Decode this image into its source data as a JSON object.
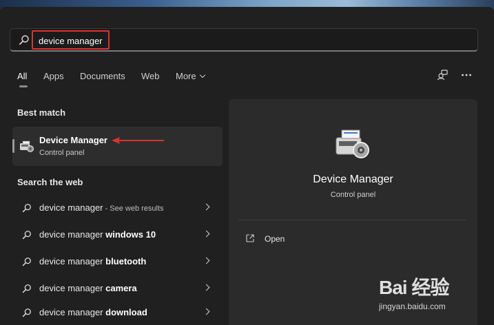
{
  "search": {
    "query": "device manager"
  },
  "tabs": [
    {
      "label": "All",
      "active": true
    },
    {
      "label": "Apps"
    },
    {
      "label": "Documents"
    },
    {
      "label": "Web"
    },
    {
      "label": "More"
    }
  ],
  "best_match": {
    "heading": "Best match",
    "title": "Device Manager",
    "subtitle": "Control panel",
    "icon": "device-manager-icon"
  },
  "web": {
    "heading": "Search the web",
    "results": [
      {
        "prefix": "device manager",
        "bold": "",
        "hint": " - See web results"
      },
      {
        "prefix": "device manager ",
        "bold": "windows 10",
        "hint": ""
      },
      {
        "prefix": "device manager ",
        "bold": "bluetooth",
        "hint": ""
      },
      {
        "prefix": "device manager ",
        "bold": "camera",
        "hint": ""
      },
      {
        "prefix": "device manager ",
        "bold": "download",
        "hint": ""
      }
    ]
  },
  "detail": {
    "title": "Device Manager",
    "subtitle": "Control panel",
    "open_label": "Open"
  },
  "watermark": {
    "logo": "Bai 经验",
    "url": "jingyan.baidu.com"
  },
  "colors": {
    "highlight": "#e03131",
    "panel": "#202020",
    "card": "#2d2d2d"
  }
}
